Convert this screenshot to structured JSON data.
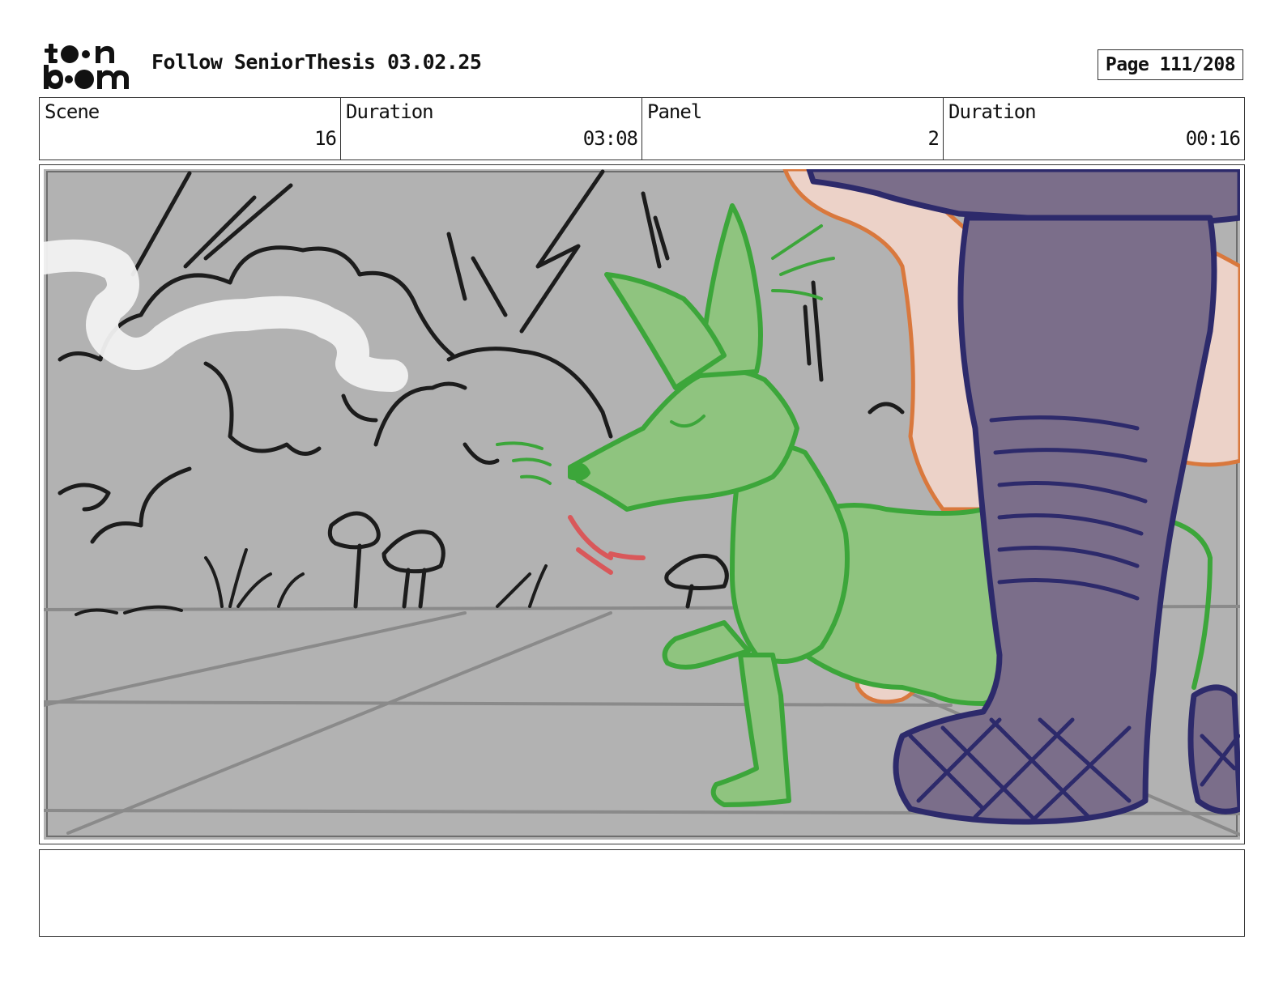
{
  "logo": {
    "line1": "toon",
    "line2": "boom"
  },
  "header": {
    "project_title": "Follow SeniorThesis 03.02.25",
    "page_label": "Page 111/208"
  },
  "info": [
    {
      "label": "Scene",
      "value": "16"
    },
    {
      "label": "Duration",
      "value": "03:08"
    },
    {
      "label": "Panel",
      "value": "2"
    },
    {
      "label": "Duration",
      "value": "00:16"
    }
  ],
  "notes": {
    "text": ""
  },
  "colors": {
    "background_gray": "#b2b2b2",
    "ground_line": "#8a8a8a",
    "dog_fill": "#8fc47f",
    "dog_line": "#3ca63a",
    "pants_fill": "#7b6e8a",
    "pants_line": "#2d2a6b",
    "skin_fill": "#ecd2c8",
    "skin_line": "#d9783d",
    "smoke": "#f2f2f2",
    "tongue": "#d9585a"
  }
}
